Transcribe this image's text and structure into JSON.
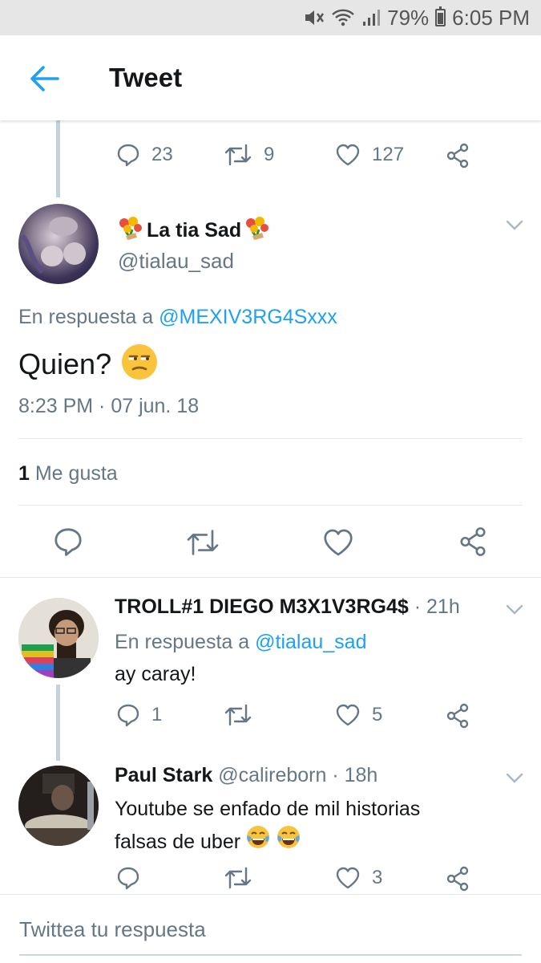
{
  "status_bar": {
    "battery": "79%",
    "time": "6:05 PM"
  },
  "header": {
    "title": "Tweet"
  },
  "parent_tweet_actions": {
    "replies": "23",
    "retweets": "9",
    "likes": "127"
  },
  "main_tweet": {
    "display_name": "La tia Sad",
    "handle": "@tialau_sad",
    "reply_prefix": "En respuesta a",
    "reply_to": "@MEXIV3RG4Sxxx",
    "text": "Quien?",
    "timestamp": "8:23 PM · 07 jun. 18",
    "likes_count": "1",
    "likes_label": "Me gusta"
  },
  "replies": [
    {
      "display_name": "TROLL#1 DIEGO M3X1V3RG4$",
      "time": "· 21h",
      "reply_prefix": "En respuesta a",
      "reply_to": "@tialau_sad",
      "text": "ay caray!",
      "replies": "1",
      "retweets": "",
      "likes": "5"
    },
    {
      "display_name": "Paul Stark",
      "handle": "@calireborn",
      "time": "· 18h",
      "text_line1": "Youtube se enfado de mil historias",
      "text_line2": "falsas de uber",
      "replies": "",
      "retweets": "",
      "likes": "3"
    }
  ],
  "composer": {
    "placeholder": "Twittea tu respuesta"
  },
  "colors": {
    "accent": "#1da1f2",
    "muted": "#657786",
    "thread_line": "#c4d2dc"
  }
}
